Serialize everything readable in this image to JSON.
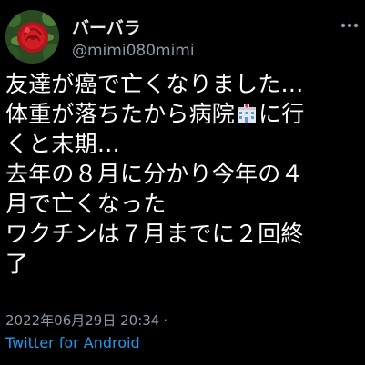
{
  "user": {
    "display_name": "バーバラ",
    "handle": "@mimi080mimi",
    "avatar_icon": "red-rose-avatar"
  },
  "tweet": {
    "line1": "友達が癌で亡くなりました…",
    "line2_before": "体重が落ちたから病院",
    "line2_emoji": "hospital-emoji",
    "line2_after": "に行",
    "line3": "くと末期…",
    "line4": "去年の８月に分かり今年の４",
    "line5": "月で亡くなった",
    "line6": "ワクチンは７月までに２回終",
    "line7": "了"
  },
  "meta": {
    "timestamp": "2022年06月29日 20:34",
    "separator": "·",
    "source": "Twitter for Android"
  },
  "colors": {
    "background": "#000000",
    "text": "#ffffff",
    "secondary": "#8b98a5",
    "link": "#1d9bf0"
  }
}
